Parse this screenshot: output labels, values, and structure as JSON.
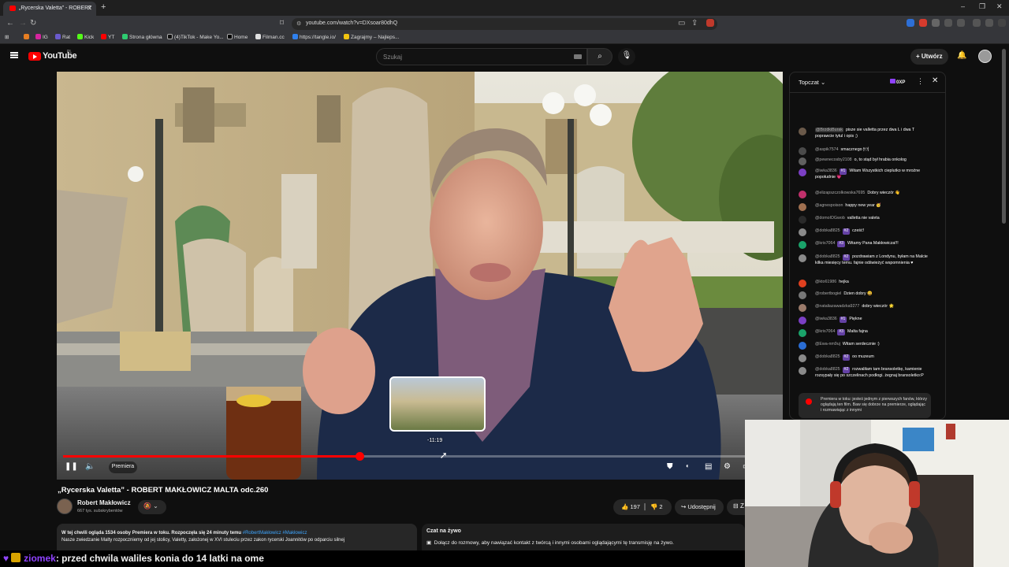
{
  "browser": {
    "tab_title": "„Rycerska Valetta” - ROBERT",
    "url": "youtube.com/watch?v=DXsoar80dhQ",
    "bookmarks": [
      "IG",
      "Rat",
      "Kick",
      "YT",
      "Strona główna",
      "(4)TikTok - Make Yo...",
      "Home",
      "Filman.cc",
      "https://tangle.io/",
      "Zagrajmy – Najleps..."
    ]
  },
  "header": {
    "logo_text": "YouTube",
    "region": "PL",
    "search_placeholder": "Szukaj",
    "create_label": "Utwórz"
  },
  "player": {
    "thumbnail_time": "-11:19",
    "premiere_label": "Premiera",
    "progress_fraction": 0.415,
    "hover_fraction": 0.53
  },
  "video": {
    "title": "„Rycerska Valetta” - ROBERT MAKŁOWICZ MALTA odc.260",
    "channel": "Robert Makłowicz",
    "subscribers": "667 tys. subskrybentów",
    "likes": "197",
    "dislikes": "2",
    "share_label": "Udostępnij",
    "save_label": "Z",
    "description_line1_bold": "W tej chwili ogląda 1534 osoby  Premiera w toku. Rozpoczęła się 24 minuty temu",
    "description_tags": "#RobertMakłowicz #Makłowicz",
    "description_line2": "Nasze zwiedzanie Malty rozpoczniemy od jej stolicy, Valetty, założonej w XVI stuleciu przez zakon rycerski Joannitów po odparciu silnej",
    "livechat_title": "Czat na żywo",
    "livechat_text": "Dołącz do rozmowy, aby nawiązać kontakt z twórcą i innymi osobami oglądającymi tę transmisję na żywo."
  },
  "chat": {
    "mode": "Topczat",
    "xp": "0XP",
    "messages": [
      {
        "author": "@BrzdkiBurak",
        "text": "pisze sie valletta przez dwa L i dwa T poprawcie tytul i opis ;)",
        "badge": "",
        "color": "#6b5a4a"
      },
      {
        "author": "@aspik7574",
        "text": "smacznego 🍽",
        "badge": "",
        "color": "#4a4a4a"
      },
      {
        "author": "@pewnecosby2108",
        "text": "o, to stąd był hrabia onkolog",
        "badge": "",
        "color": "#606060"
      },
      {
        "author": "@iwka3836",
        "text": "Witam Wszystkich cieplutko w mroźne popołudnie 💗",
        "badge": "#1",
        "color": "#7b3fc4"
      },
      {
        "author": "@elizapszczolkowska7695",
        "text": "Dobry wieczór 👋",
        "badge": "",
        "color": "#c0306b"
      },
      {
        "author": "@agnespoison",
        "text": "happy new year 🥳",
        "badge": "",
        "color": "#a07050"
      },
      {
        "author": "@domolOGwob",
        "text": "valletta nie valeta",
        "badge": "",
        "color": "#2a2a2a"
      },
      {
        "author": "@dobka8825",
        "text": "cześć!",
        "badge": "#2",
        "color": "#8a8a8a"
      },
      {
        "author": "@kris7064",
        "text": "Witamy Pana Makłowicza!!!",
        "badge": "#3",
        "color": "#1aa36a"
      },
      {
        "author": "@dobka8825",
        "text": "pozdrawiam z Londynu, byłam na Malcie kilka miesięcy temu. fajnie odświeżyć wspomnienia ♥",
        "badge": "#2",
        "color": "#8a8a8a"
      },
      {
        "author": "@kto61986",
        "text": "hejka",
        "badge": "",
        "color": "#e0401f"
      },
      {
        "author": "@robertbogiel",
        "text": "Dzien dobry 😀",
        "badge": "",
        "color": "#777"
      },
      {
        "author": "@nataliazawadzka9277",
        "text": "dobry wieczór 🌟",
        "badge": "",
        "color": "#9a7a6a"
      },
      {
        "author": "@iwka3836",
        "text": "Piękne",
        "badge": "#1",
        "color": "#7b3fc4"
      },
      {
        "author": "@kris7064",
        "text": "Malta fajna",
        "badge": "#3",
        "color": "#1aa36a"
      },
      {
        "author": "@Ewa-nm9uj",
        "text": "Witam serdecznie :)",
        "badge": "",
        "color": "#2a6dd4"
      },
      {
        "author": "@dobka8825",
        "text": "oo muzeum",
        "badge": "#2",
        "color": "#8a8a8a"
      },
      {
        "author": "@dobka8825",
        "text": "rozwaliłam tam bransoletkę, kamienie rozsypały się po szczelinach podłogi. żegnaj bransoletko:P",
        "badge": "#2",
        "color": "#8a8a8a"
      }
    ],
    "premiere_note": "Premiera w toku: jesteś jednym z pierwszych fanów, którzy oglądają ten film. Baw się dobrze na premierze, oglądając i rozmawiając z innymi"
  },
  "overlay": {
    "user": "ziomek",
    "message": ": przed chwila waliles konia do 14 latki na ome"
  },
  "colors": {
    "accent": "#ff0000",
    "member_badge": "#6441a5",
    "overlay_user": "#8f42ff"
  }
}
